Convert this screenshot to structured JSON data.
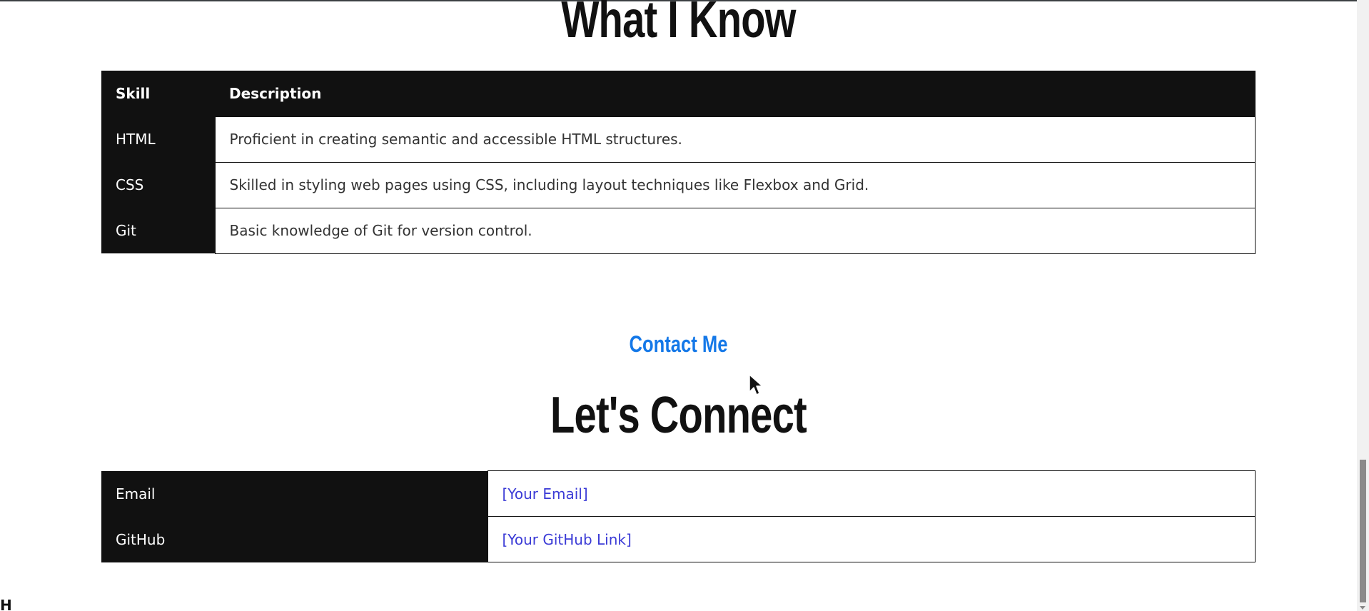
{
  "about_section": {
    "heading": "What I Know",
    "table_headers": [
      "Skill",
      "Description"
    ],
    "rows": [
      {
        "skill": "HTML",
        "description": "Proficient in creating semantic and accessible HTML structures."
      },
      {
        "skill": "CSS",
        "description": "Skilled in styling web pages using CSS, including layout techniques like Flexbox and Grid."
      },
      {
        "skill": "Git",
        "description": "Basic knowledge of Git for version control."
      }
    ]
  },
  "contact_section": {
    "eyebrow": "Contact Me",
    "heading": "Let's Connect",
    "rows": [
      {
        "label": "Email",
        "value": "[Your Email]"
      },
      {
        "label": "GitHub",
        "value": "[Your GitHub Link]"
      }
    ]
  },
  "footer_partial": {
    "glyph": "H"
  },
  "colors": {
    "accent": "#1478e8",
    "link": "#3b3bd6",
    "dark": "#111111"
  },
  "icons": {
    "cursor": "mouse-pointer-icon",
    "scroll_down": "chevron-down-icon"
  }
}
